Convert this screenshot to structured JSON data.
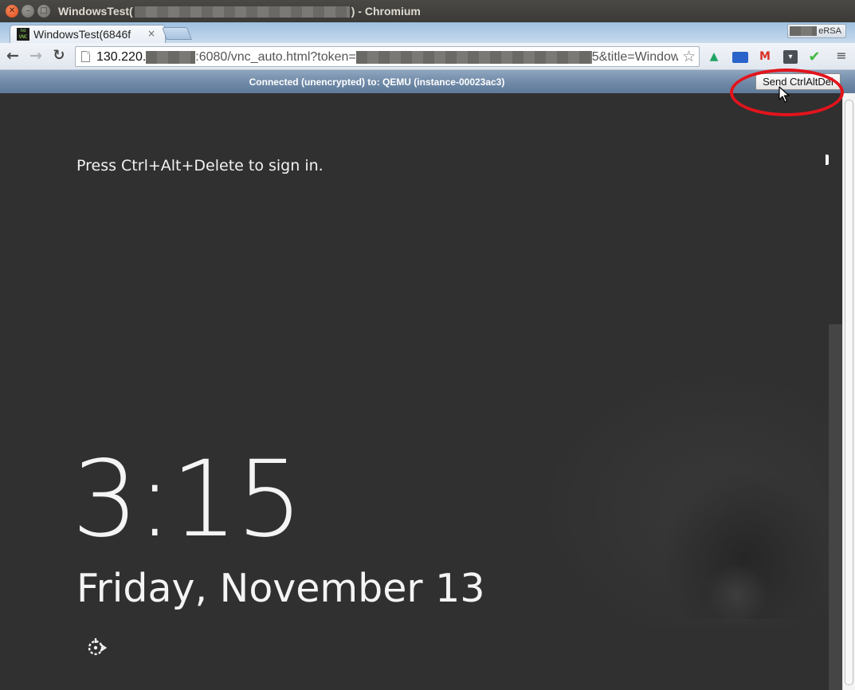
{
  "window": {
    "title_prefix": "WindowsTest(",
    "title_suffix": ") - Chromium"
  },
  "tab": {
    "title": "WindowsTest(6846f",
    "close_glyph": "×"
  },
  "profile": {
    "label": "eRSA"
  },
  "toolbar": {
    "back_glyph": "←",
    "forward_glyph": "→",
    "reload_glyph": "↻",
    "star_glyph": "☆",
    "menu_glyph": "≡"
  },
  "address": {
    "host_start": "130.220.",
    "path_mid": ":6080/vnc_auto.html?token=",
    "path_end": "5&title=Window"
  },
  "extensions": [
    {
      "icon": "google-drive-icon",
      "glyph": "▲"
    },
    {
      "icon": "cast-icon",
      "glyph": ""
    },
    {
      "icon": "gmail-icon",
      "glyph": "M"
    },
    {
      "icon": "pocket-icon",
      "glyph": "▾"
    },
    {
      "icon": "checkmark-icon",
      "glyph": "✔"
    }
  ],
  "vnc": {
    "status": "Connected (unencrypted) to: QEMU (instance-00023ac3)",
    "cad_button": "Send CtrlAltDel"
  },
  "lockscreen": {
    "hint": "Press Ctrl+Alt+Delete to sign in.",
    "time": "3:15",
    "date": "Friday, November 13"
  },
  "colors": {
    "annotation": "#e3141c",
    "vnc_bar": "#6f89a7",
    "screen_bg": "#303030"
  }
}
